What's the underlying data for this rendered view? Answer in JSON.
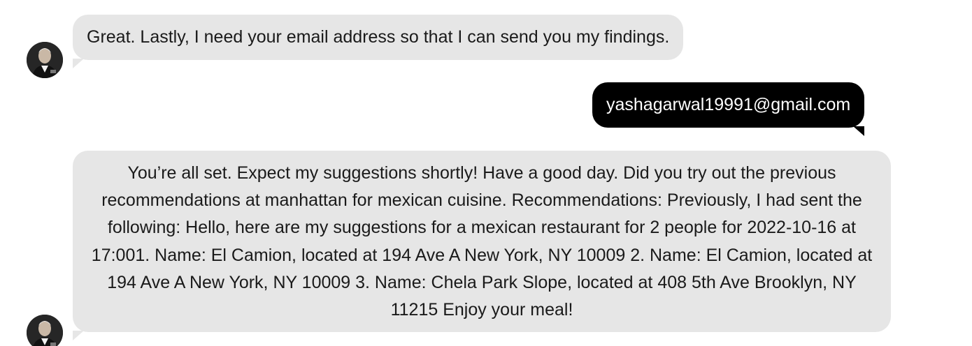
{
  "messages": [
    {
      "sender": "bot",
      "text": "Great. Lastly, I need your email address so that I can send you my findings."
    },
    {
      "sender": "user",
      "text": "yashagarwal19991@gmail.com"
    },
    {
      "sender": "bot",
      "text": "You’re all set. Expect my suggestions shortly! Have a good day. Did you try out the previous recommendations at manhattan for mexican cuisine. Recommendations: Previously, I had sent the following: Hello, here are my suggestions for a mexican restaurant for 2 people for 2022-10-16 at 17:001. Name: El Camion, located at 194 Ave A New York, NY 10009 2. Name: El Camion, located at 194 Ave A New York, NY 10009 3. Name: Chela Park Slope, located at 408 5th Ave Brooklyn, NY 11215 Enjoy your meal!"
    }
  ],
  "colors": {
    "bot_bubble": "#e6e6e6",
    "user_bubble": "#000000",
    "user_text": "#ffffff",
    "bot_text": "#1a1a1a"
  },
  "icons": {
    "bot_avatar": "bot-avatar-icon"
  }
}
